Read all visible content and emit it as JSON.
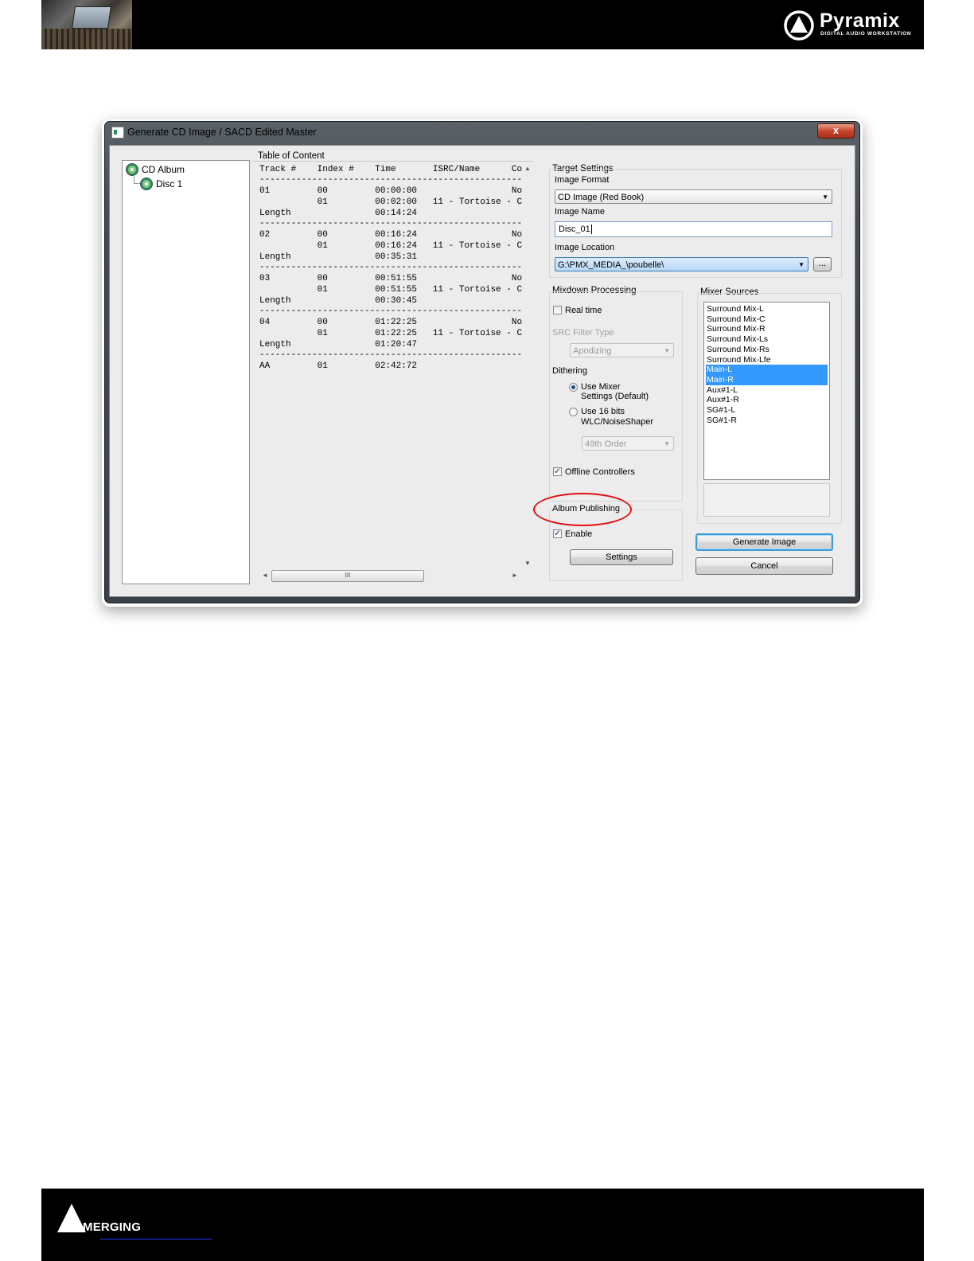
{
  "header": {
    "brand": "Pyramix",
    "brand_sub": "DIGITAL AUDIO WORKSTATION"
  },
  "footer": {
    "brand": "MERGING"
  },
  "dialog": {
    "title": "Generate CD Image / SACD Edited Master",
    "close_label": "x",
    "tree": {
      "root": "CD Album",
      "child": "Disc 1"
    },
    "toc": {
      "label": "Table of Content",
      "lines": [
        "Track #    Index #    Time       ISRC/Name      Co",
        "---------------------------------------------------",
        "01         00         00:00:00                  No",
        "           01         00:02:00   11 - Tortoise - C",
        "Length                00:14:24",
        "---------------------------------------------------",
        "02         00         00:16:24                  No",
        "           01         00:16:24   11 - Tortoise - C",
        "Length                00:35:31",
        "---------------------------------------------------",
        "03         00         00:51:55                  No",
        "           01         00:51:55   11 - Tortoise - C",
        "Length                00:30:45",
        "---------------------------------------------------",
        "04         00         01:22:25                  No",
        "           01         01:22:25   11 - Tortoise - C",
        "Length                01:20:47",
        "---------------------------------------------------",
        "AA         01         02:42:72"
      ],
      "scroll_up": "▲",
      "scroll_down": "▼",
      "scroll_left": "◄",
      "scroll_right": "►",
      "thumb_grip": "III"
    },
    "target": {
      "label": "Target Settings",
      "image_format_label": "Image Format",
      "image_format_value": "CD Image (Red Book)",
      "image_name_label": "Image Name",
      "image_name_value": "Disc_01",
      "image_location_label": "Image Location",
      "image_location_value": "G:\\PMX_MEDIA_\\poubelle\\",
      "browse_label": "..."
    },
    "mixdown": {
      "label": "Mixdown Processing",
      "realtime_label": "Real time",
      "src_label": "SRC Filter Type",
      "src_value": "Apodizing",
      "dithering_label": "Dithering",
      "radio1_line1": "Use Mixer",
      "radio1_line2": "Settings (Default)",
      "radio2_line1": "Use 16 bits",
      "radio2_line2": "WLC/NoiseShaper",
      "order_value": "49th Order",
      "offline_label": "Offline Controllers",
      "check_mark": "✓"
    },
    "album_publishing": {
      "label": "Album Publishing",
      "enable_label": "Enable",
      "settings_label": "Settings"
    },
    "mixer_sources": {
      "label": "Mixer Sources",
      "items": [
        "Surround Mix-L",
        "Surround Mix-C",
        "Surround Mix-R",
        "Surround Mix-Ls",
        "Surround Mix-Rs",
        "Surround Mix-Lfe",
        "Main-L",
        "Main-R",
        "Aux#1-L",
        "Aux#1-R",
        "SG#1-L",
        "SG#1-R"
      ]
    },
    "buttons": {
      "generate": "Generate Image",
      "cancel": "Cancel"
    }
  }
}
